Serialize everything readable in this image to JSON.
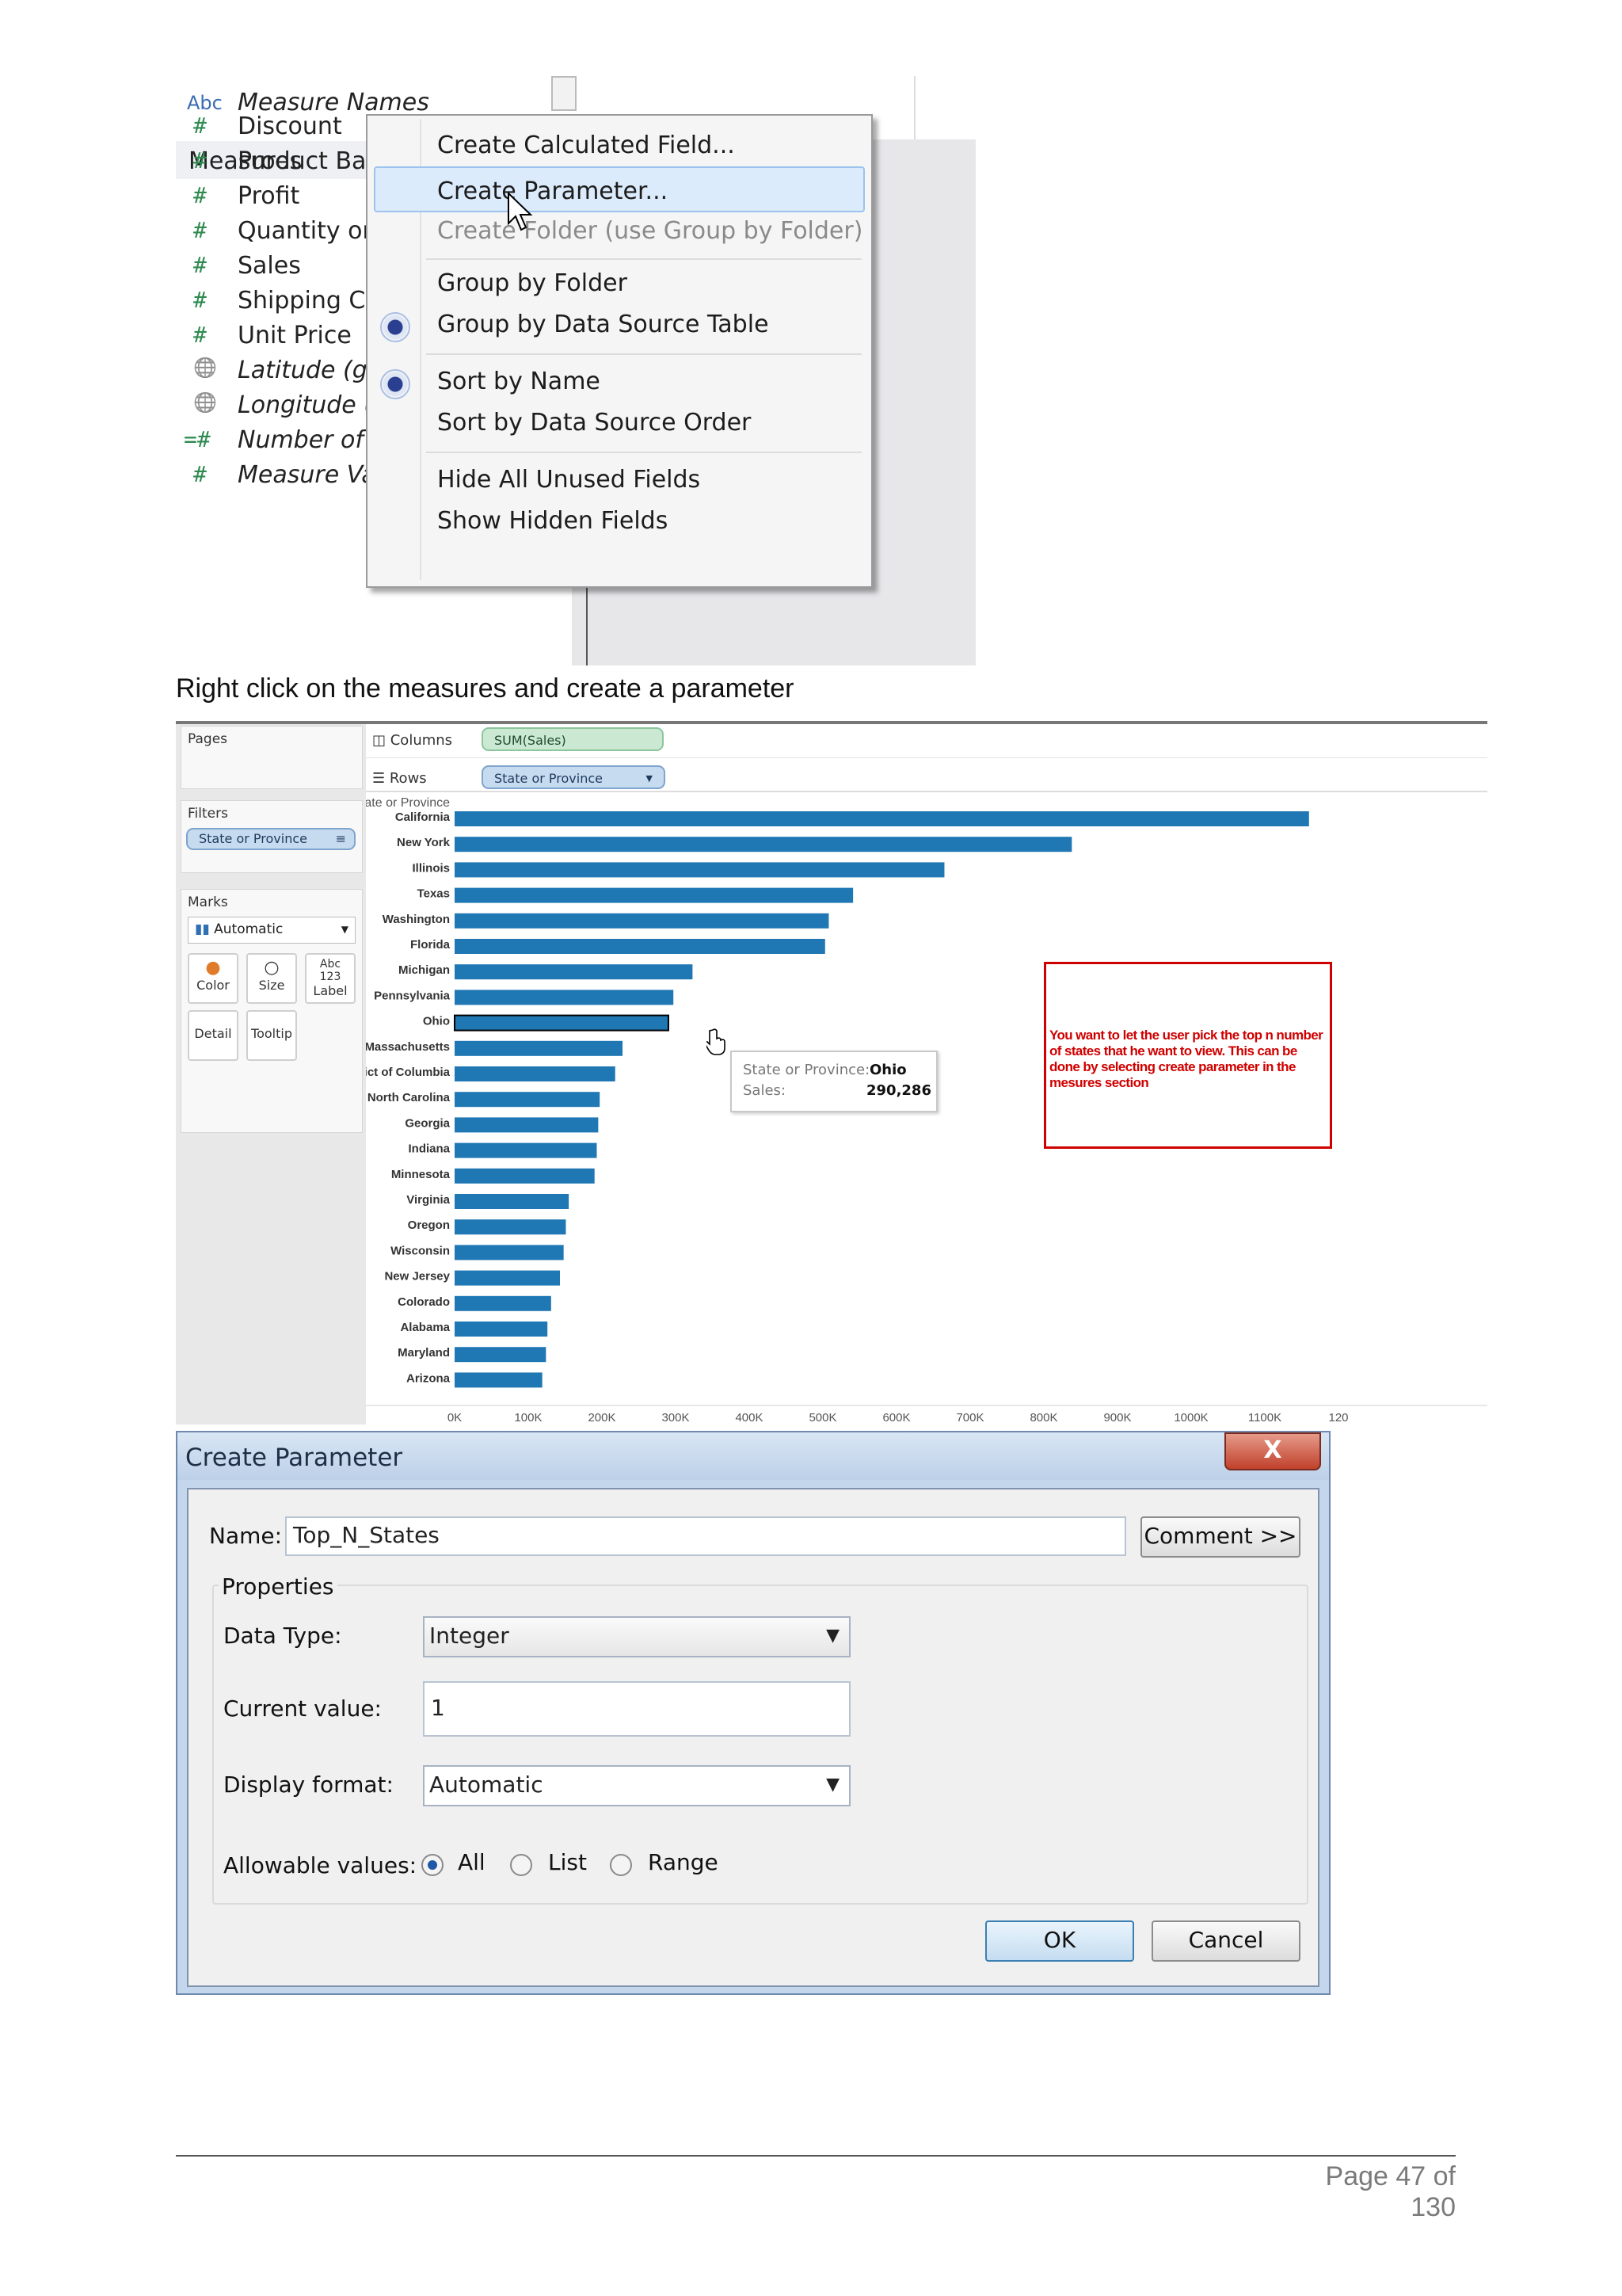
{
  "screenshot1": {
    "tree": {
      "abc_icon": "Abc",
      "measure_names": "Measure Names",
      "measures_header": "Measures",
      "measures": [
        {
          "icon": "#",
          "label": "Discount",
          "italic": false
        },
        {
          "icon": "#",
          "label": "Product Bas",
          "italic": false
        },
        {
          "icon": "#",
          "label": "Profit",
          "italic": false
        },
        {
          "icon": "#",
          "label": "Quantity or",
          "italic": false
        },
        {
          "icon": "#",
          "label": "Sales",
          "italic": false
        },
        {
          "icon": "#",
          "label": "Shipping Co",
          "italic": false
        },
        {
          "icon": "#",
          "label": "Unit Price",
          "italic": false
        },
        {
          "icon": "globe",
          "label": "Latitude (ge",
          "italic": true
        },
        {
          "icon": "globe",
          "label": "Longitude (g",
          "italic": true
        },
        {
          "icon": "=#",
          "label": "Number of R",
          "italic": true
        },
        {
          "icon": "#",
          "label": "Measure Va",
          "italic": true
        }
      ]
    },
    "context_menu": {
      "items": [
        {
          "label": "Create Calculated Field...",
          "disabled": false
        },
        {
          "label": "Create Parameter...",
          "disabled": false,
          "highlighted": true
        },
        {
          "label": "Create Folder (use Group by Folder)",
          "disabled": true
        },
        {
          "label": "Group by Folder",
          "disabled": false
        },
        {
          "label": "Group by Data Source Table",
          "disabled": false,
          "checked": true
        },
        {
          "label": "Sort by Name",
          "disabled": false,
          "checked": true
        },
        {
          "label": "Sort by Data Source Order",
          "disabled": false
        },
        {
          "label": "Hide All Unused Fields",
          "disabled": false
        },
        {
          "label": "Show Hidden Fields",
          "disabled": false
        }
      ]
    }
  },
  "caption1": "Right click on the measures and create a parameter",
  "screenshot2": {
    "left_pane": {
      "pages_label": "Pages",
      "filters_label": "Filters",
      "filter_pill": "State or Province",
      "marks_label": "Marks",
      "marks_type": "Automatic",
      "buttons": [
        "Color",
        "Size",
        "Label",
        "Detail",
        "Tooltip"
      ]
    },
    "shelves": {
      "columns_label": "Columns",
      "columns_pill": "SUM(Sales)",
      "rows_label": "Rows",
      "rows_pill": "State or Province"
    },
    "annotation": "You want to let the user pick the top n number of states that he want to view. This can be done by selecting create parameter in the mesures section",
    "tooltip": {
      "key1": "State or Province:",
      "val1": "Ohio",
      "key2": "Sales:",
      "val2": "290,286"
    }
  },
  "chart_data": {
    "type": "bar",
    "orientation": "horizontal",
    "row_header": "State or Province",
    "xlabel": "Sales",
    "categories": [
      "California",
      "New York",
      "Illinois",
      "Texas",
      "Washington",
      "Florida",
      "Michigan",
      "Pennsylvania",
      "Ohio",
      "Massachusetts",
      "District of Columbia",
      "North Carolina",
      "Georgia",
      "Indiana",
      "Minnesota",
      "Virginia",
      "Oregon",
      "Wisconsin",
      "New Jersey",
      "Colorado",
      "Alabama",
      "Maryland",
      "Arizona"
    ],
    "values": [
      1160000,
      838000,
      665000,
      541000,
      508000,
      503000,
      323000,
      297000,
      290286,
      228000,
      218000,
      197000,
      195000,
      193000,
      190000,
      155000,
      151000,
      148000,
      143000,
      131000,
      126000,
      124000,
      119000
    ],
    "highlighted": "Ohio",
    "xticks": [
      "0K",
      "100K",
      "200K",
      "300K",
      "400K",
      "500K",
      "600K",
      "700K",
      "800K",
      "900K",
      "1000K",
      "1100K",
      "120"
    ],
    "xlim": [
      0,
      1200000
    ],
    "bar_color": "#1f77b4"
  },
  "dialog": {
    "title": "Create Parameter",
    "close_label": "X",
    "name_label": "Name:",
    "name_value": "Top_N_States",
    "comment_button": "Comment >>",
    "properties_label": "Properties",
    "data_type_label": "Data Type:",
    "data_type_value": "Integer",
    "current_value_label": "Current value:",
    "current_value": "1",
    "display_format_label": "Display format:",
    "display_format_value": "Automatic",
    "allowable_label": "Allowable values:",
    "allowable_options": [
      "All",
      "List",
      "Range"
    ],
    "allowable_selected": "All",
    "ok_button": "OK",
    "cancel_button": "Cancel"
  },
  "footer": {
    "page": "Page 47 of 130"
  }
}
